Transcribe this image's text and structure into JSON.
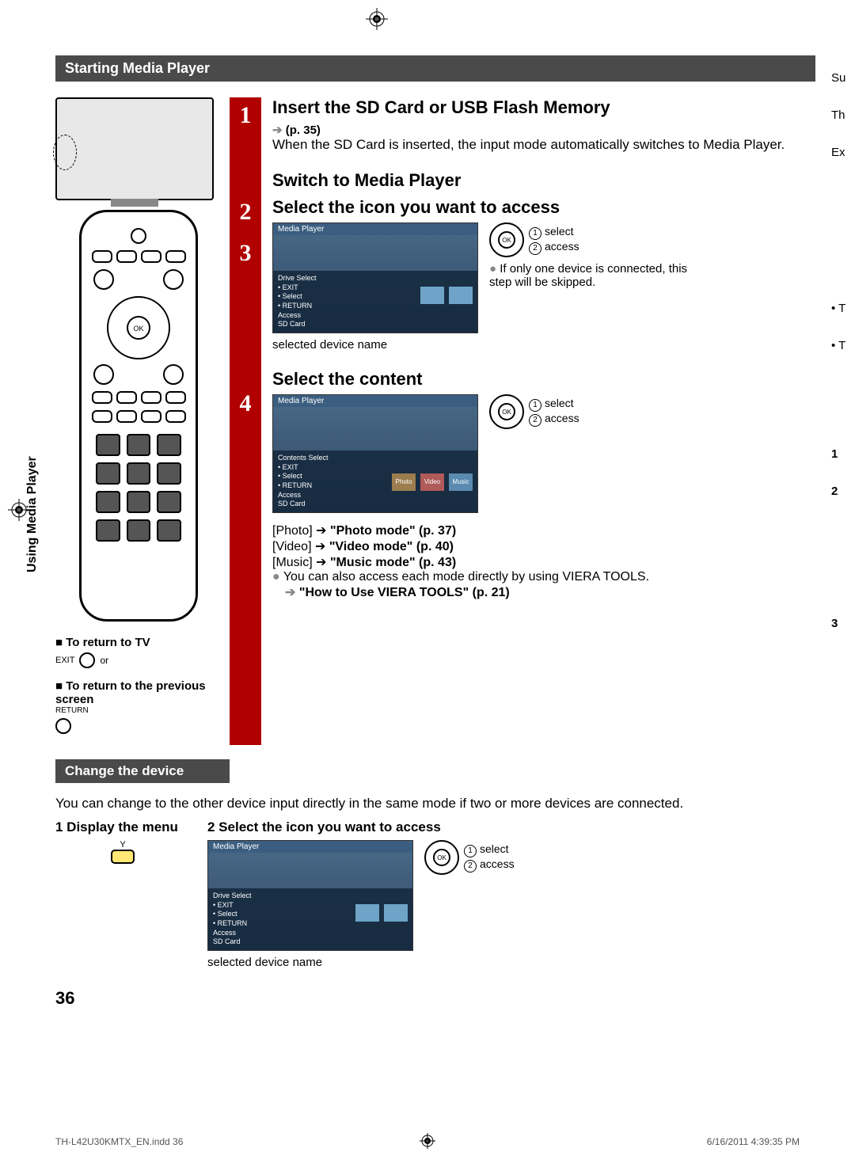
{
  "section_title": "Starting Media Player",
  "sidebar_label": "Using Media Player",
  "steps": {
    "s1": {
      "title": "Insert the SD Card or USB Flash Memory",
      "page_ref": "(p. 35)",
      "body": "When the SD Card is inserted, the input mode automatically switches to Media Player."
    },
    "s2": {
      "title": "Switch to Media Player"
    },
    "s3": {
      "title": "Select the icon you want to access",
      "ok_select": "select",
      "ok_access": "access",
      "note": "If only one device is connected, this step will be skipped.",
      "caption": "selected device name",
      "screen_title": "Media Player",
      "screen_menu_exit": "EXIT",
      "screen_menu_select": "Select",
      "screen_menu_return": "RETURN",
      "screen_menu_access": "Access",
      "screen_menu_sd": "SD Card",
      "screen_menu_drive": "Drive Select"
    },
    "s4": {
      "title": "Select the content",
      "ok_select": "select",
      "ok_access": "access",
      "screen_title": "Media Player",
      "screen_section": "Contents Select",
      "screen_menu_exit": "EXIT",
      "screen_menu_select": "Select",
      "screen_menu_return": "RETURN",
      "screen_menu_access": "Access",
      "screen_menu_sd": "SD Card",
      "tabs": {
        "photo": "Photo",
        "video": "Video",
        "music": "Music"
      },
      "lines": {
        "photo": "[Photo]",
        "photo_mode": "\"Photo mode\" (p. 37)",
        "video": "[Video]",
        "video_mode": "\"Video mode\" (p. 40)",
        "music": "[Music]",
        "music_mode": "\"Music mode\" (p. 43)"
      },
      "viera_note": "You can also access each mode directly by using VIERA TOOLS.",
      "viera_ref": "\"How to Use VIERA TOOLS\" (p. 21)"
    }
  },
  "hints": {
    "return_tv": "To return to TV",
    "exit_label": "EXIT",
    "or": "or",
    "prev_screen": "To return to the previous screen",
    "return_label": "RETURN"
  },
  "change_device": {
    "heading": "Change the device",
    "body": "You can change to the other device input directly in the same mode if two or more devices are connected.",
    "step1": "1 Display the menu",
    "ybtn": "Y",
    "step2": "2 Select the icon you want to access",
    "ok_select": "select",
    "ok_access": "access",
    "caption": "selected device name"
  },
  "page_number": "36",
  "footer": {
    "file": "TH-L42U30KMTX_EN.indd   36",
    "timestamp": "6/16/2011   4:39:35 PM"
  },
  "next_page_fragments": [
    "Su",
    "Th",
    "Ex",
    "T",
    "T",
    "1",
    "2",
    "3"
  ]
}
